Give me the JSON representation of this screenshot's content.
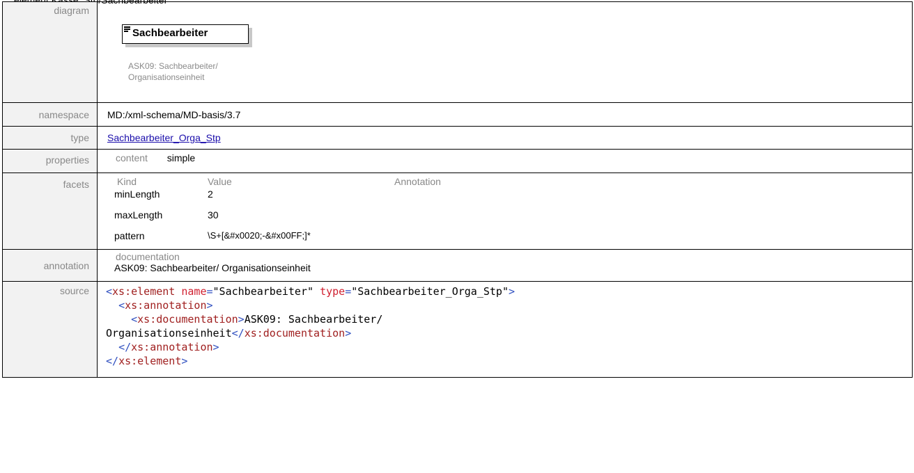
{
  "caption": "element Kasse_Stp/Sachbearbeiter",
  "diagram": {
    "label": "diagram",
    "element_name": "Sachbearbeiter",
    "note_line1": "ASK09: Sachbearbeiter/",
    "note_line2": "Organisationseinheit"
  },
  "namespace": {
    "label": "namespace",
    "value": "MD:/xml-schema/MD-basis/3.7"
  },
  "type": {
    "label": "type",
    "value": "Sachbearbeiter_Orga_Stp"
  },
  "properties": {
    "label": "properties",
    "key": "content",
    "value": "simple"
  },
  "facets": {
    "label": "facets",
    "headers": {
      "kind": "Kind",
      "value": "Value",
      "annotation": "Annotation"
    },
    "rows": [
      {
        "kind": "minLength",
        "value": "2"
      },
      {
        "kind": "maxLength",
        "value": "30"
      },
      {
        "kind": "pattern",
        "value": "\\S+[&#x0020;-&#x00FF;]*"
      }
    ]
  },
  "annotation": {
    "label": "annotation",
    "key": "documentation",
    "value": "ASK09: Sachbearbeiter/ Organisationseinheit"
  },
  "source": {
    "label": "source",
    "lt": "<",
    "gt": ">",
    "close_lt": "</",
    "eq": "=",
    "tag_element": "xs:element",
    "tag_annotation": "xs:annotation",
    "tag_documentation": "xs:documentation",
    "attr_name": "name",
    "attr_name_value": "\"Sachbearbeiter\"",
    "attr_type": "type",
    "attr_type_value": "\"Sachbearbeiter_Orga_Stp\"",
    "doc_text_line1": "ASK09: Sachbearbeiter/",
    "doc_text_line2": "Organisationseinheit"
  },
  "colors": {
    "label_bg": "#f2f2f2",
    "label_text": "#888888",
    "link": "#1a0dab",
    "xml_bracket": "#3050c0",
    "xml_tag": "#a02020",
    "xml_attr": "#d02030"
  }
}
